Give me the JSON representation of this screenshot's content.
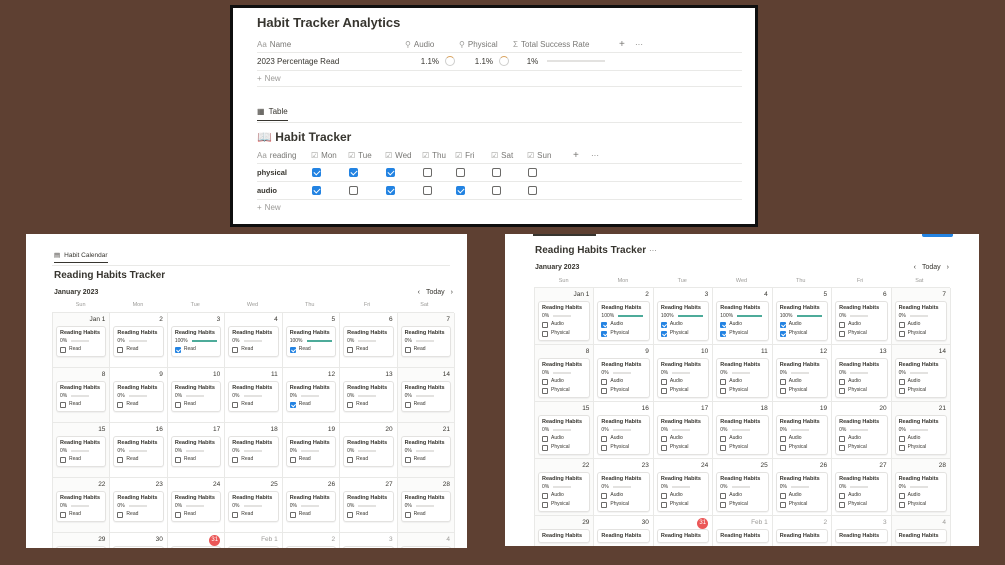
{
  "analytics": {
    "title": "Habit Tracker Analytics",
    "columns": [
      "Name",
      "Audio",
      "Physical",
      "Total Success Rate"
    ],
    "col_icons": [
      "Aa",
      "⚲",
      "⚲",
      "Σ"
    ],
    "add": "+",
    "more": "···",
    "row": {
      "name": "2023 Percentage Read",
      "audio": "1.1%",
      "physical": "1.1%",
      "total": "1%"
    },
    "new_label": "New"
  },
  "view_tab": "Table",
  "tracker": {
    "title": "Habit Tracker",
    "columns": [
      "reading",
      "Mon",
      "Tue",
      "Wed",
      "Thu",
      "Fri",
      "Sat",
      "Sun"
    ],
    "rows": [
      {
        "name": "physical",
        "checks": [
          true,
          true,
          true,
          false,
          false,
          false,
          false
        ]
      },
      {
        "name": "audio",
        "checks": [
          true,
          false,
          true,
          false,
          true,
          false,
          false
        ]
      }
    ],
    "new_label": "New"
  },
  "calendar_left": {
    "tab": "Habit Calendar",
    "title": "Reading Habits Tracker",
    "month": "January 2023",
    "today_label": "Today",
    "days": [
      "Sun",
      "Mon",
      "Tue",
      "Wed",
      "Thu",
      "Fri",
      "Sat"
    ],
    "weeks": [
      [
        "Jan 1",
        "2",
        "3",
        "4",
        "5",
        "6",
        "7"
      ],
      [
        "8",
        "9",
        "10",
        "11",
        "12",
        "13",
        "14"
      ],
      [
        "15",
        "16",
        "17",
        "18",
        "19",
        "20",
        "21"
      ],
      [
        "22",
        "23",
        "24",
        "25",
        "26",
        "27",
        "28"
      ],
      [
        "29",
        "30",
        "31",
        "Feb 1",
        "2",
        "3",
        "4"
      ]
    ],
    "card_title": "Reading Habits",
    "check_label": "Read",
    "percent_done": [
      0,
      0,
      100,
      0,
      100,
      0,
      0,
      0,
      0,
      0,
      0,
      0,
      0,
      0,
      0,
      0,
      0,
      0,
      0,
      0,
      0,
      0,
      0,
      0,
      0,
      0,
      0,
      0
    ],
    "checks": [
      false,
      false,
      true,
      false,
      true,
      false,
      false,
      false,
      false,
      false,
      false,
      true,
      false,
      false,
      false,
      false,
      false,
      false,
      false,
      false,
      false,
      false,
      false,
      false,
      false,
      false,
      false,
      false
    ]
  },
  "calendar_right": {
    "title": "Reading Habits Tracker",
    "more": "···",
    "month": "January 2023",
    "today_label": "Today",
    "days": [
      "Sun",
      "Mon",
      "Tue",
      "Wed",
      "Thu",
      "Fri",
      "Sat"
    ],
    "weeks": [
      [
        "Jan 1",
        "2",
        "3",
        "4",
        "5",
        "6",
        "7"
      ],
      [
        "8",
        "9",
        "10",
        "11",
        "12",
        "13",
        "14"
      ],
      [
        "15",
        "16",
        "17",
        "18",
        "19",
        "20",
        "21"
      ],
      [
        "22",
        "23",
        "24",
        "25",
        "26",
        "27",
        "28"
      ],
      [
        "29",
        "30",
        "31",
        "Feb 1",
        "2",
        "3",
        "4"
      ]
    ],
    "card_title": "Reading Habits",
    "labels": [
      "Audio",
      "Physical"
    ],
    "percent_done": [
      0,
      100,
      100,
      100,
      100,
      0,
      0,
      0,
      0,
      0,
      0,
      0,
      0,
      0,
      0,
      0,
      0,
      0,
      0,
      0,
      0,
      0,
      0,
      0,
      0,
      0,
      0,
      0
    ],
    "audio": [
      false,
      true,
      true,
      true,
      true,
      false,
      false,
      false,
      false,
      false,
      false,
      false,
      false,
      false,
      false,
      false,
      false,
      false,
      false,
      false,
      false,
      false,
      false,
      false,
      false,
      false,
      false,
      false
    ],
    "physical": [
      false,
      true,
      true,
      true,
      true,
      false,
      false,
      false,
      false,
      false,
      false,
      false,
      false,
      false,
      false,
      false,
      false,
      false,
      false,
      false,
      false,
      false,
      false,
      false,
      false,
      false,
      false,
      false
    ]
  },
  "today_day": "31",
  "colors": {
    "background": "#5e4032",
    "accent": "#2383e2",
    "progress": "#4dab9a",
    "today": "#eb5757"
  }
}
